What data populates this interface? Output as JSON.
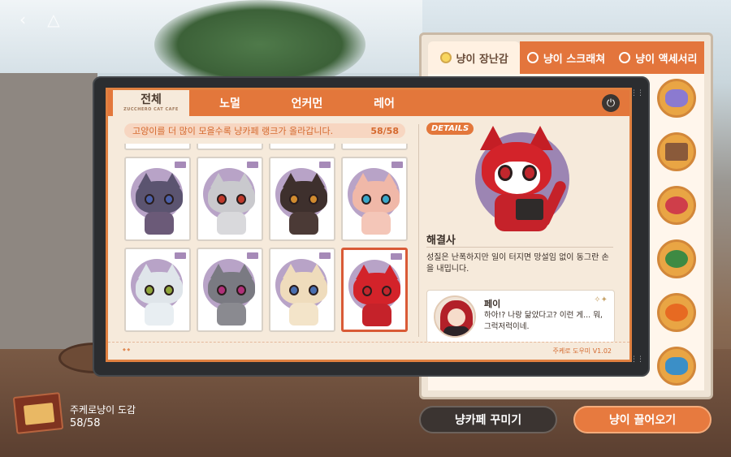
{
  "top_nav": {
    "back_icon": "back-chevron-icon",
    "home_icon": "home-triangle-icon"
  },
  "side_panel": {
    "tabs": [
      {
        "label": "냥이 장난감",
        "active": true
      },
      {
        "label": "냥이 스크래쳐",
        "active": false
      },
      {
        "label": "냥이 액세서리",
        "active": false
      }
    ],
    "toys": [
      "dolphin-toy-icon",
      "gift-box-toy-icon",
      "yarn-ball-toy-icon",
      "watermelon-toy-icon",
      "pumpkin-toy-icon",
      "fish-toy-icon"
    ]
  },
  "bottom_buttons": {
    "decorate": "냥카페 꾸미기",
    "recruit": "냥이 끌어오기"
  },
  "dex": {
    "title": "주케로냥이 도감",
    "count": "58/58"
  },
  "tablet": {
    "tabs": [
      {
        "label": "전체",
        "sub": "ZUCCHERO CAT CAFE",
        "active": true
      },
      {
        "label": "노멀"
      },
      {
        "label": "언커먼"
      },
      {
        "label": "레어"
      }
    ],
    "notice": {
      "text": "고양이를 더 많이 모을수록 냥카페 랭크가 올라갑니다.",
      "count": "58/58"
    },
    "cards": [
      {
        "body": "#6b5a78",
        "head": "#5b5470",
        "eye": "#4a5fa8"
      },
      {
        "body": "#d9d9dc",
        "head": "#c9c9cd",
        "eye": "#c0392b"
      },
      {
        "body": "#4b3a36",
        "head": "#3e302d",
        "eye": "#d18b2f"
      },
      {
        "body": "#f4c6b8",
        "head": "#f0b8a8",
        "eye": "#3aa7c9"
      },
      {
        "body": "#e8eef2",
        "head": "#dfe5ea",
        "eye": "#8fa53a"
      },
      {
        "body": "#8a8a90",
        "head": "#7a7a82",
        "eye": "#b0307a"
      },
      {
        "body": "#f3e4c9",
        "head": "#efdcbc",
        "eye": "#4a6fb0"
      },
      {
        "body": "#c5222a",
        "head": "#d3232a",
        "eye": "#c1272d",
        "selected": true
      }
    ],
    "details": {
      "tag": "DETAILS",
      "name": "해결사",
      "description": "성질은 난폭하지만 일이 터지면 망설임 없이 동그란 손을 내밉니다.",
      "quote": {
        "speaker": "페이",
        "text": "하아!? 나랑 닮았다고? 이런 게... 뭐, 그럭저럭이네."
      }
    },
    "footer": {
      "version": "주케로 도우미 V1.02"
    }
  }
}
